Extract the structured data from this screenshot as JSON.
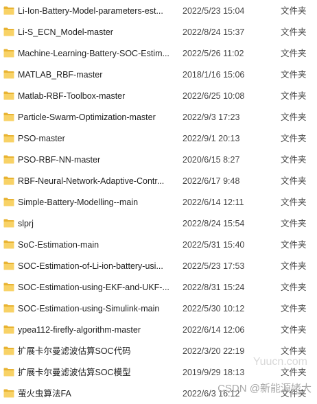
{
  "folder_icon": "folder-icon",
  "colors": {
    "folder_back": "#E8B332",
    "folder_front": "#F8D266"
  },
  "files": [
    {
      "name": "Li-Ion-Battery-Model-parameters-est...",
      "date": "2022/5/23 15:04",
      "type": "文件夹"
    },
    {
      "name": "Li-S_ECN_Model-master",
      "date": "2022/8/24 15:37",
      "type": "文件夹"
    },
    {
      "name": "Machine-Learning-Battery-SOC-Estim...",
      "date": "2022/5/26 11:02",
      "type": "文件夹"
    },
    {
      "name": "MATLAB_RBF-master",
      "date": "2018/1/16 15:06",
      "type": "文件夹"
    },
    {
      "name": "Matlab-RBF-Toolbox-master",
      "date": "2022/6/25 10:08",
      "type": "文件夹"
    },
    {
      "name": "Particle-Swarm-Optimization-master",
      "date": "2022/9/3 17:23",
      "type": "文件夹"
    },
    {
      "name": "PSO-master",
      "date": "2022/9/1 20:13",
      "type": "文件夹"
    },
    {
      "name": "PSO-RBF-NN-master",
      "date": "2020/6/15 8:27",
      "type": "文件夹"
    },
    {
      "name": "RBF-Neural-Network-Adaptive-Contr...",
      "date": "2022/6/17 9:48",
      "type": "文件夹"
    },
    {
      "name": "Simple-Battery-Modelling--main",
      "date": "2022/6/14 12:11",
      "type": "文件夹"
    },
    {
      "name": "slprj",
      "date": "2022/8/24 15:54",
      "type": "文件夹"
    },
    {
      "name": "SoC-Estimation-main",
      "date": "2022/5/31 15:40",
      "type": "文件夹"
    },
    {
      "name": "SOC-Estimation-of-Li-ion-battery-usi...",
      "date": "2022/5/23 17:53",
      "type": "文件夹"
    },
    {
      "name": "SOC-Estimation-using-EKF-and-UKF-...",
      "date": "2022/8/31 15:24",
      "type": "文件夹"
    },
    {
      "name": "SOC-Estimation-using-Simulink-main",
      "date": "2022/5/30 10:12",
      "type": "文件夹"
    },
    {
      "name": "ypea112-firefly-algorithm-master",
      "date": "2022/6/14 12:06",
      "type": "文件夹"
    },
    {
      "name": "扩展卡尔曼滤波估算SOC代码",
      "date": "2022/3/20 22:19",
      "type": "文件夹"
    },
    {
      "name": "扩展卡尔曼滤波估算SOC模型",
      "date": "2019/9/29 18:13",
      "type": "文件夹"
    },
    {
      "name": "萤火虫算法FA",
      "date": "2022/6/3 16:12",
      "type": "文件夹"
    }
  ],
  "watermarks": {
    "site": "Yuucn.com",
    "author": "CSDN @新能源姥大"
  }
}
